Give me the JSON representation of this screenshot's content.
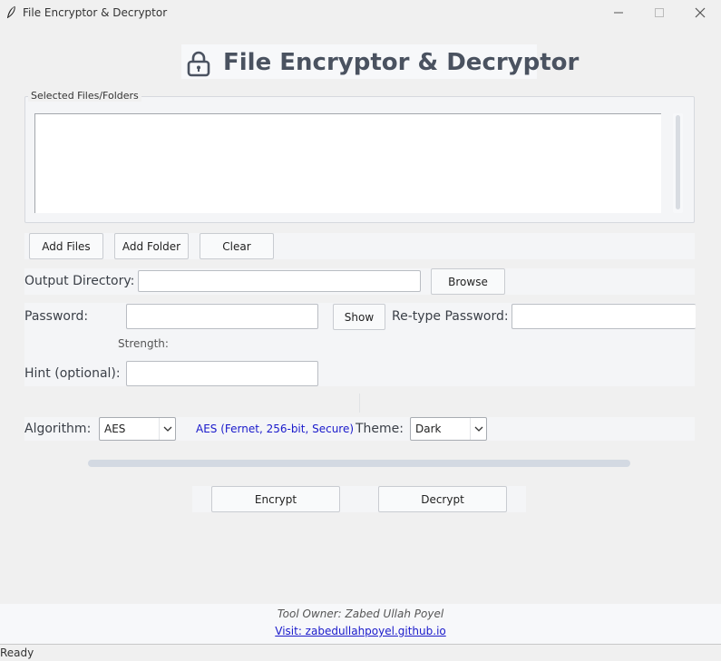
{
  "window": {
    "title": "File Encryptor & Decryptor",
    "icon": "feather-icon",
    "controls": [
      "minimize-icon",
      "maximize-icon",
      "close-icon"
    ]
  },
  "header": {
    "icon": "lock-icon",
    "title": "File Encryptor & Decryptor"
  },
  "files_group": {
    "legend": "Selected Files/Folders",
    "items": []
  },
  "file_buttons": {
    "add_files": "Add Files",
    "add_folder": "Add Folder",
    "clear": "Clear"
  },
  "output": {
    "label": "Output Directory:",
    "value": "",
    "browse": "Browse"
  },
  "password": {
    "label": "Password:",
    "value": "",
    "show": "Show",
    "retype_label": "Re-type Password:",
    "retype_value": "",
    "strength_label": "Strength:",
    "hint_label": "Hint (optional):",
    "hint_value": ""
  },
  "settings": {
    "algorithm_label": "Algorithm:",
    "algorithm_value": "AES",
    "algorithm_info": "AES (Fernet, 256-bit, Secure)",
    "theme_label": "Theme:",
    "theme_value": "Dark"
  },
  "progress": {
    "fraction": 0
  },
  "actions": {
    "encrypt": "Encrypt",
    "decrypt": "Decrypt"
  },
  "footer": {
    "owner": "Tool Owner: Zabed Ullah Poyel",
    "visit": "Visit: zabedullahpoyel.github.io"
  },
  "status": "Ready",
  "colors": {
    "link": "#1a1acb",
    "heading": "#4a5260",
    "progress_track": "#d3d9e2"
  }
}
